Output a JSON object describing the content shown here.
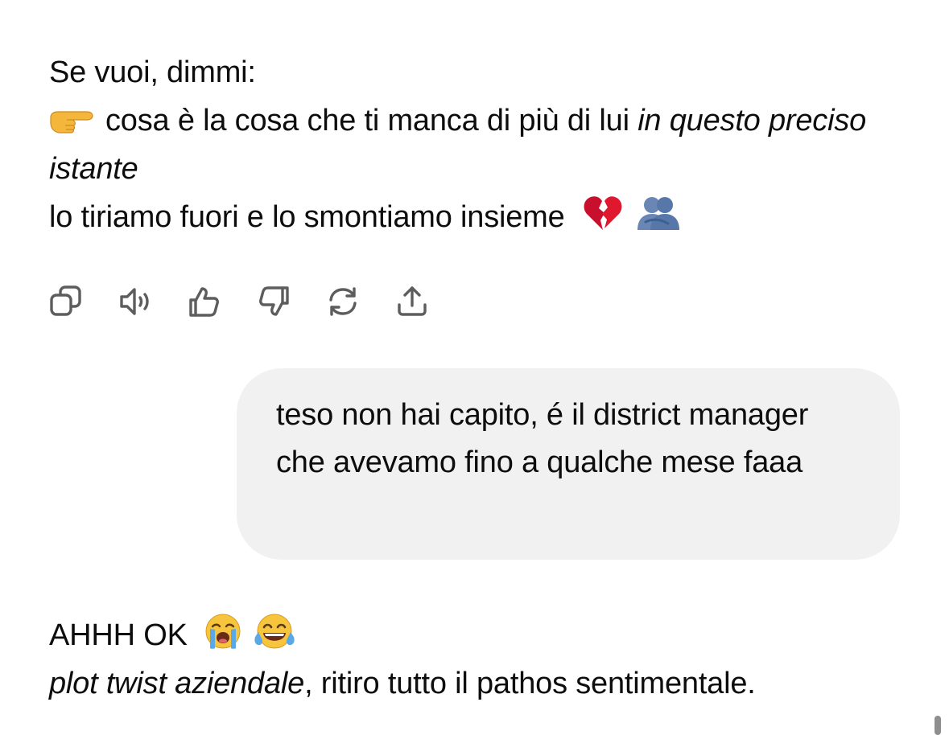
{
  "message_1": {
    "line_1": "Se vuoi, dimmi:",
    "pointer_emoji": "backhand-index-pointing-right",
    "line_2_text": "cosa è la cosa che ti manca di più di lui ",
    "line_2_italic": "in questo preciso istante",
    "line_3": "lo tiriamo fuori e lo smontiamo insieme",
    "line_3_emojis": [
      "broken-heart",
      "people-hugging"
    ]
  },
  "action_bar": {
    "icons": [
      "copy-icon",
      "read-aloud-icon",
      "thumbs-up-icon",
      "thumbs-down-icon",
      "regenerate-icon",
      "share-icon"
    ]
  },
  "user_message": {
    "text": "teso non hai capito, é il district manager che avevamo fino a qualche mese faaa"
  },
  "message_2": {
    "line_1": "AHHH OK",
    "line_1_emojis": [
      "loudly-crying-face",
      "face-with-tears-of-joy"
    ],
    "line_2_italic": "plot twist aziendale",
    "line_2_text": ", ritiro tutto il pathos sentimentale."
  },
  "colors": {
    "text": "#0d0d0d",
    "bubble": "#f1f1f1",
    "icon": "#5d5d5d"
  }
}
